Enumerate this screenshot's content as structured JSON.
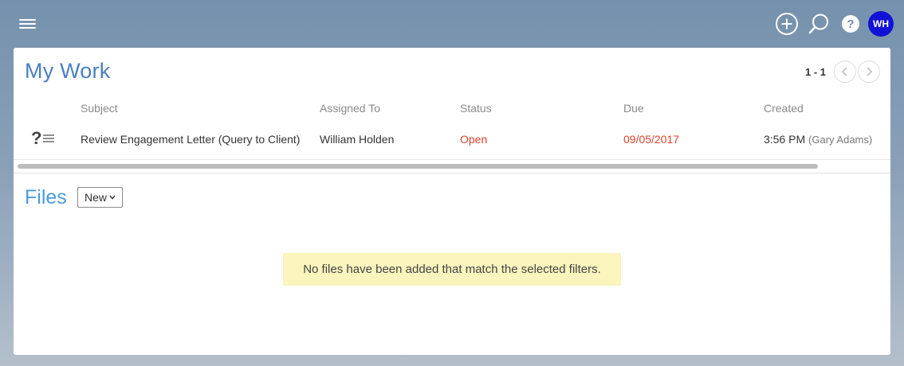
{
  "topbar": {
    "menu_icon": "hamburger-icon",
    "add_icon": "plus-circle-icon",
    "search_icon": "search-icon",
    "help_icon": "help-icon",
    "avatar_initials": "WH",
    "avatar_color": "#1212d6"
  },
  "mywork": {
    "title": "My Work",
    "pager": {
      "range": "1 - 1",
      "prev_icon": "chevron-left-icon",
      "next_icon": "chevron-right-icon"
    },
    "columns": [
      "Subject",
      "Assigned To",
      "Status",
      "Due",
      "Created"
    ],
    "rows": [
      {
        "type_icon": "question-list-icon",
        "subject": "Review Engagement Letter (Query to Client)",
        "assigned_to": "William Holden",
        "status": "Open",
        "due": "09/05/2017",
        "created_time": "3:56 PM",
        "created_by": "(Gary Adams)"
      }
    ]
  },
  "files": {
    "title": "Files",
    "new_button": "New",
    "empty_message": "No files have been added that match the selected filters."
  },
  "colors": {
    "accent_title": "#4a7fc0",
    "files_title": "#4a9be0",
    "overdue_red": "#d9432f",
    "notice_yellow": "#fbf4bd"
  }
}
